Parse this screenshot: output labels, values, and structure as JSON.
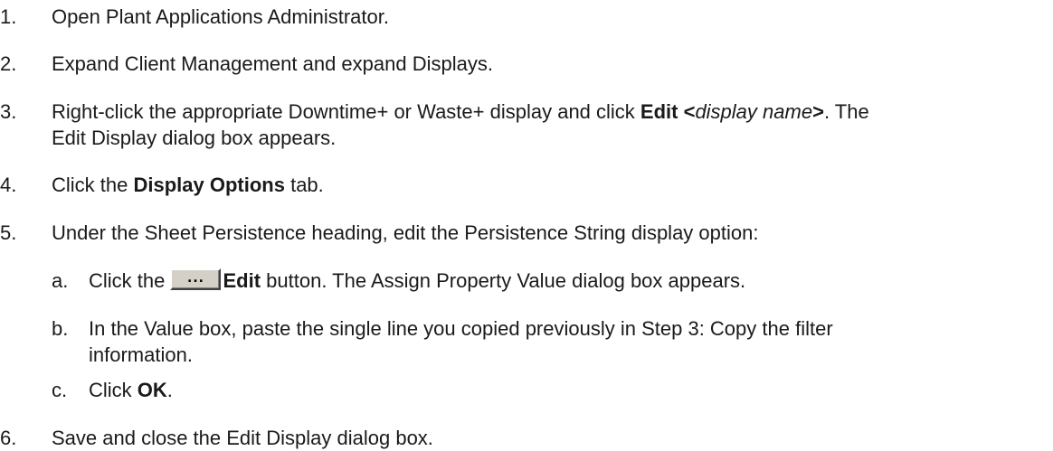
{
  "steps": [
    {
      "num": "1.",
      "text": "Open Plant Applications Administrator."
    },
    {
      "num": "2.",
      "text": "Expand Client Management and expand Displays."
    },
    {
      "num": "3.",
      "pre": "Right-click the appropriate Downtime+ or Waste+ display and click ",
      "bold_a": "Edit <",
      "ital": "display name",
      "bold_b": ">",
      "post_l1": ". The",
      "line2": "Edit Display dialog box appears."
    },
    {
      "num": "4.",
      "pre": "Click the ",
      "bold": "Display Options",
      "post": " tab."
    },
    {
      "num": "5.",
      "text": "Under the Sheet Persistence heading, edit the Persistence String display option:"
    },
    {
      "num": "6.",
      "text": "Save and close the Edit Display dialog box."
    }
  ],
  "substeps": [
    {
      "num": "a.",
      "pre": "Click the ",
      "button_glyph": "...",
      "bold": "Edit",
      "post": " button. The Assign Property Value dialog box appears."
    },
    {
      "num": "b.",
      "line1": "In the Value box, paste the single line you copied previously in Step 3: Copy the filter",
      "line2": "information."
    },
    {
      "num": "c.",
      "pre": "Click ",
      "bold": "OK",
      "post": "."
    }
  ]
}
